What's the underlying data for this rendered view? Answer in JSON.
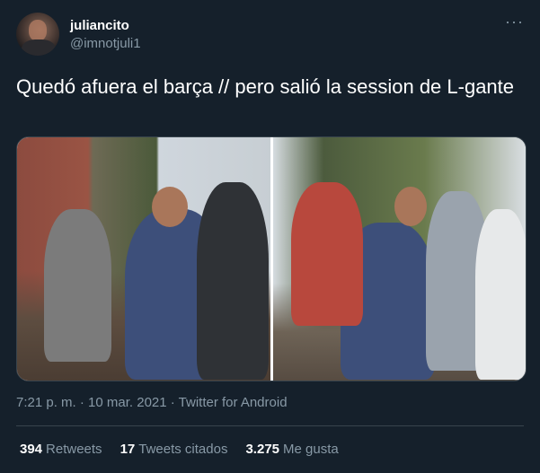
{
  "author": {
    "display_name": "juliancito",
    "handle": "@imnotjuli1"
  },
  "tweet": {
    "text": "Quedó afuera el barça // pero salió la session de L-gante",
    "more_icon": "more-horizontal-icon",
    "timestamp": "7:21 p. m. · 10 mar. 2021 · Twitter for Android"
  },
  "stats": {
    "retweets_count": "394",
    "retweets_label": "Retweets",
    "quotes_count": "17",
    "quotes_label": "Tweets citados",
    "likes_count": "3.275",
    "likes_label": "Me gusta"
  },
  "colors": {
    "background": "#15202b",
    "secondary_text": "#8899a6",
    "divider": "#38444d"
  }
}
